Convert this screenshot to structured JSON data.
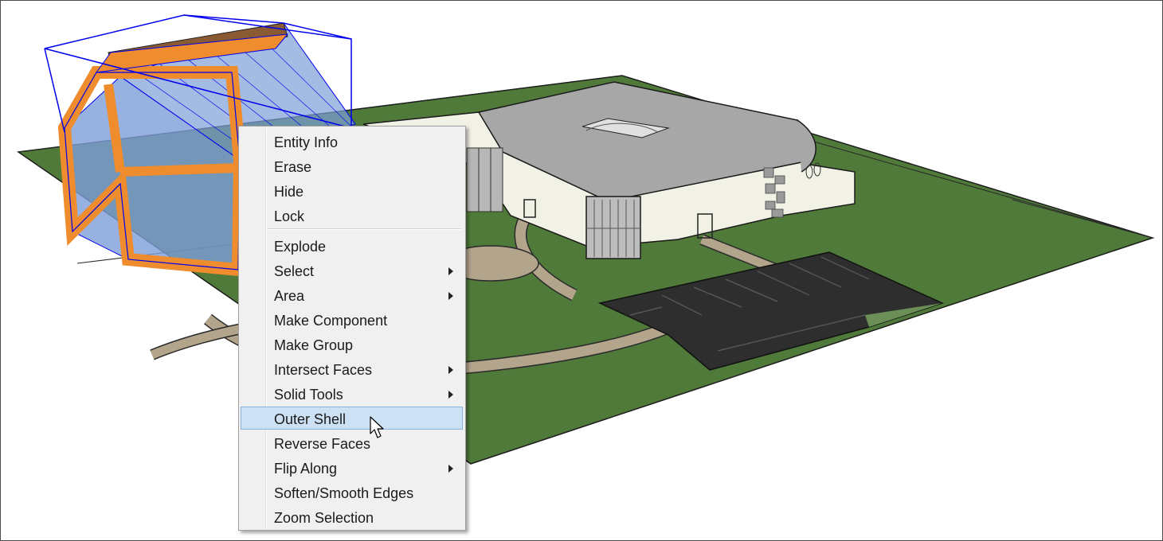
{
  "context_menu": {
    "items": [
      {
        "label": "Entity Info"
      },
      {
        "label": "Erase"
      },
      {
        "label": "Hide"
      },
      {
        "label": "Lock"
      },
      {
        "label": "Explode"
      },
      {
        "label": "Select",
        "submenu": true
      },
      {
        "label": "Area",
        "submenu": true
      },
      {
        "label": "Make Component"
      },
      {
        "label": "Make Group"
      },
      {
        "label": "Intersect Faces",
        "submenu": true
      },
      {
        "label": "Solid Tools",
        "submenu": true
      },
      {
        "label": "Outer Shell",
        "highlighted": true
      },
      {
        "label": "Reverse Faces"
      },
      {
        "label": "Flip Along",
        "submenu": true
      },
      {
        "label": "Soften/Smooth Edges"
      },
      {
        "label": "Zoom Selection"
      }
    ]
  },
  "colors": {
    "grass": "#4f7a39",
    "path": "#b3a48c",
    "parking": "#2e2e2e",
    "roof": "#a7a7a7",
    "wall": "#f2f1e6",
    "selection_blue": "#0000ee",
    "frame_orange": "#ee8c2e",
    "glass": "#7d9fd9",
    "menu_highlight": "#cde1f4"
  }
}
